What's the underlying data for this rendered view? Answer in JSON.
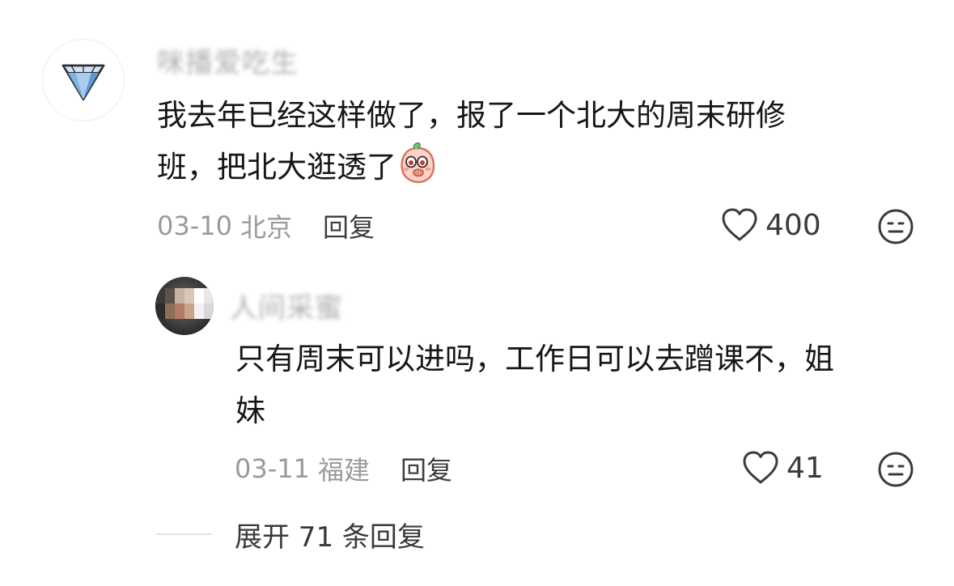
{
  "comment": {
    "username": "咪播爱吃生",
    "text_line1": "我去年已经这样做了，报了一个北大的周末研修",
    "text_line2": "班，把北大逛透了",
    "sticker": "peach-covering-mouth-sticker",
    "date": "03-10",
    "location": "北京",
    "reply_label": "回复",
    "likes": "400",
    "avatar_icon": "diamond-icon",
    "like_icon": "heart-outline-icon",
    "dislike_icon": "unhappy-face-icon"
  },
  "reply": {
    "username": "人间采蜜",
    "text_line1": "只有周末可以进吗，工作日可以去蹭课不，姐",
    "text_line2": "妹",
    "date": "03-11",
    "location": "福建",
    "reply_label": "回复",
    "likes": "41",
    "like_icon": "heart-outline-icon",
    "dislike_icon": "unhappy-face-icon"
  },
  "expand": {
    "label": "展开 71 条回复"
  },
  "colors": {
    "text_primary": "#161616",
    "text_meta": "#9a9a9a",
    "text_action": "#3d3d3d",
    "diamond_blue": "#5b9bd5"
  }
}
